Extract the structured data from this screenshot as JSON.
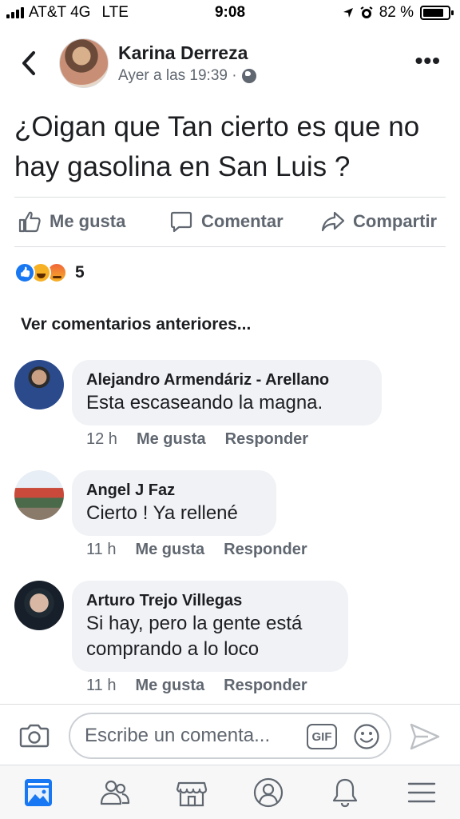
{
  "status_bar": {
    "carrier": "AT&T 4G",
    "network": "LTE",
    "time": "9:08",
    "battery_percent": "82 %",
    "battery_level": 0.82
  },
  "post": {
    "author": "Karina Derreza",
    "meta": "Ayer a las 19:39 ·",
    "text": "¿Oigan que Tan cierto es que no hay gasolina en San Luis ?",
    "actions": {
      "like": "Me gusta",
      "comment": "Comentar",
      "share": "Compartir"
    },
    "reaction_count": "5"
  },
  "prev_comments_label": "Ver comentarios anteriores...",
  "comments": [
    {
      "author": "Alejandro Armendáriz - Arellano",
      "lines": [
        "Esta escaseando la magna."
      ],
      "time": "12 h",
      "like": "Me gusta",
      "reply": "Responder"
    },
    {
      "author": "Angel J Faz",
      "lines": [
        "Cierto ! Ya rellené"
      ],
      "time": "11 h",
      "like": "Me gusta",
      "reply": "Responder"
    },
    {
      "author": "Arturo Trejo Villegas",
      "lines": [
        "Si hay, pero la gente está",
        "comprando a lo loco"
      ],
      "time": "11 h",
      "like": "Me gusta",
      "reply": "Responder"
    }
  ],
  "composer": {
    "placeholder": "Escribe un comenta...",
    "gif_label": "GIF"
  },
  "colors": {
    "accent": "#1877f2",
    "secondary_text": "#606770",
    "bubble": "#f0f2f5"
  },
  "icons": {
    "nav": [
      "news-feed-icon",
      "friends-icon",
      "marketplace-icon",
      "profile-icon",
      "notifications-icon",
      "menu-icon"
    ]
  }
}
